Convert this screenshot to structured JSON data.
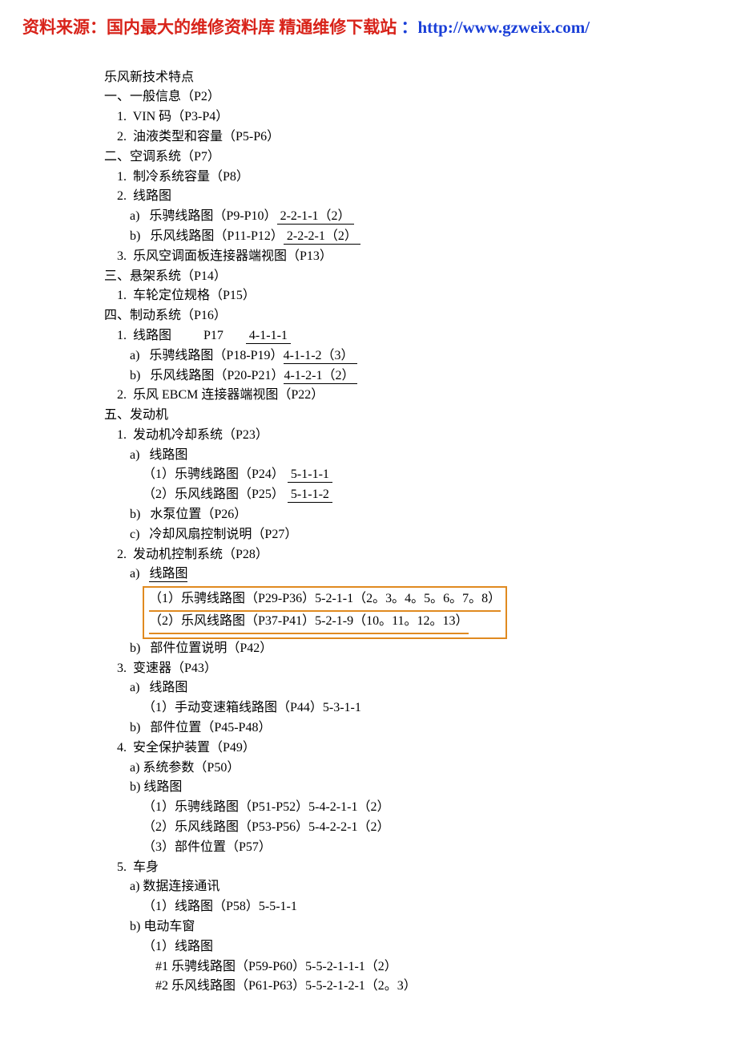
{
  "header": {
    "source_label": "资料来源：",
    "site_name": "国内最大的维修资料库 精通维修下载站",
    "sep": " ：",
    "url": "http://www.gzweix.com/"
  },
  "lines": [
    {
      "text": "乐风新技术特点",
      "indent": 0
    },
    {
      "text": "一、一般信息（P2）",
      "indent": 0
    },
    {
      "text": "1.  VIN 码（P3-P4）",
      "indent": 1
    },
    {
      "text": "2.  油液类型和容量（P5-P6）",
      "indent": 1
    },
    {
      "text": "二、空调系统（P7）",
      "indent": 0
    },
    {
      "text": "1.  制冷系统容量（P8）",
      "indent": 1
    },
    {
      "text": "2.  线路图",
      "indent": 1
    },
    {
      "text": "a)   乐骋线路图（P9-P10）",
      "indent": 2,
      "ulink": " 2-2-1-1（2） "
    },
    {
      "text": "b)   乐风线路图（P11-P12）",
      "indent": 2,
      "ulink": " 2-2-2-1（2） "
    },
    {
      "text": "3.  乐风空调面板连接器端视图（P13）",
      "indent": 1
    },
    {
      "text": "三、悬架系统（P14）",
      "indent": 0
    },
    {
      "text": "1.  车轮定位规格（P15）",
      "indent": 1
    },
    {
      "text": "四、制动系统（P16）",
      "indent": 0
    },
    {
      "text": "1.  线路图          P17       ",
      "indent": 1,
      "ulink": " 4-1-1-1 "
    },
    {
      "text": "a)   乐骋线路图（P18-P19）",
      "indent": 2,
      "ulink": "4-1-1-2（3） "
    },
    {
      "text": "b)   乐风线路图（P20-P21）",
      "indent": 2,
      "ulink": "4-1-2-1（2） "
    },
    {
      "text": "2.  乐风 EBCM 连接器端视图（P22）",
      "indent": 1
    },
    {
      "text": "五、发动机",
      "indent": 0
    },
    {
      "text": "1.  发动机冷却系统（P23）",
      "indent": 1
    },
    {
      "text": "a)   线路图",
      "indent": 2
    },
    {
      "text": "（1）乐骋线路图（P24） ",
      "indent": 3,
      "ulink": " 5-1-1-1 "
    },
    {
      "text": "（2）乐风线路图（P25） ",
      "indent": 3,
      "ulink": " 5-1-1-2 "
    },
    {
      "text": "b)   水泵位置（P26）",
      "indent": 2
    },
    {
      "text": "c)   冷却风扇控制说明（P27）",
      "indent": 2
    },
    {
      "text": "2.  发动机控制系统（P28）",
      "indent": 1
    },
    {
      "text": "a)   ",
      "indent": 2,
      "ulink": "线路图"
    },
    {
      "type": "boxstart",
      "indent": 3
    },
    {
      "hl": "（1）乐骋线路图（P29-P36）5-2-1-1（2。3。4。5。6。7。8）"
    },
    {
      "hl": "（2）乐风线路图（P37-P41）5-2-1-9（10。11。12。13）"
    },
    {
      "type": "boxend"
    },
    {
      "text": "b)   部件位置说明（P42）",
      "indent": 2
    },
    {
      "text": "",
      "indent": 0
    },
    {
      "text": "3.  变速器（P43）",
      "indent": 1
    },
    {
      "text": "a)   线路图",
      "indent": 2
    },
    {
      "text": "（1）手动变速箱线路图（P44）5-3-1-1",
      "indent": 3
    },
    {
      "text": "b)   部件位置（P45-P48）",
      "indent": 2
    },
    {
      "text": "4.  安全保护装置（P49）",
      "indent": 1
    },
    {
      "text": "a) 系统参数（P50）",
      "indent": 2
    },
    {
      "text": "b) 线路图",
      "indent": 2
    },
    {
      "text": "（1）乐骋线路图（P51-P52）5-4-2-1-1（2）",
      "indent": 3
    },
    {
      "text": "（2）乐风线路图（P53-P56）5-4-2-2-1（2）",
      "indent": 3
    },
    {
      "text": "（3）部件位置（P57）",
      "indent": 3
    },
    {
      "text": "5.  车身",
      "indent": 1
    },
    {
      "text": "a) 数据连接通讯",
      "indent": 2
    },
    {
      "text": "（1）线路图（P58）5-5-1-1",
      "indent": 3
    },
    {
      "text": "b) 电动车窗",
      "indent": 2
    },
    {
      "text": "（1）线路图",
      "indent": 3
    },
    {
      "text": "#1 乐骋线路图（P59-P60）5-5-2-1-1-1（2）",
      "indent": 4
    },
    {
      "text": "#2 乐风线路图（P61-P63）5-5-2-1-2-1（2。3）",
      "indent": 4
    }
  ],
  "indent_spaces": [
    "",
    "    ",
    "        ",
    "            ",
    "                "
  ]
}
